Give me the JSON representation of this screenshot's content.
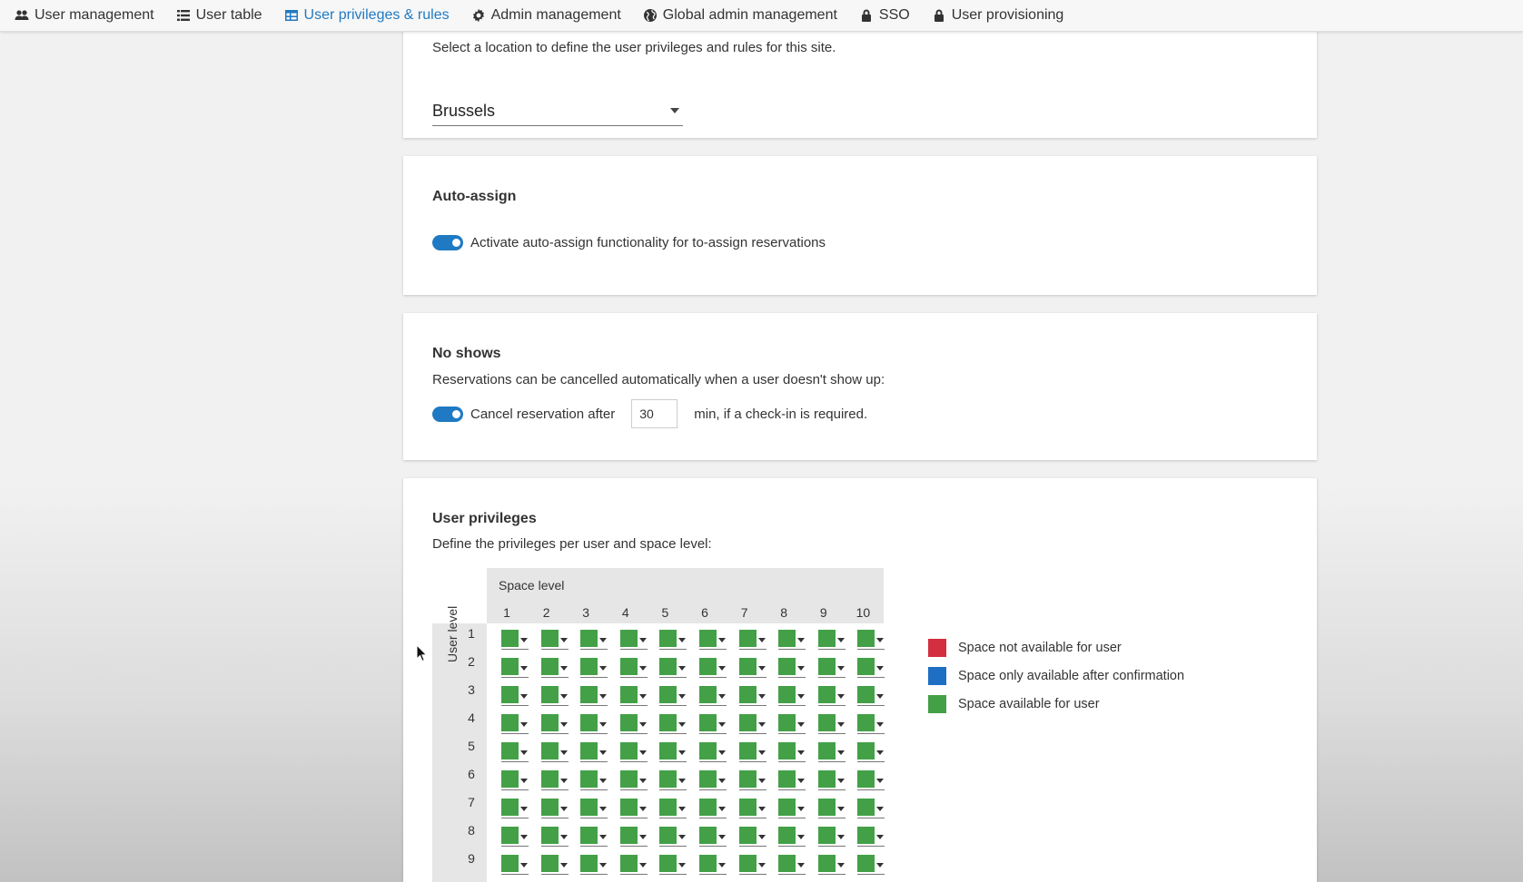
{
  "nav": {
    "tabs": [
      {
        "label": "User management",
        "icon": "users-icon",
        "active": false
      },
      {
        "label": "User table",
        "icon": "list-icon",
        "active": false
      },
      {
        "label": "User privileges & rules",
        "icon": "table-icon",
        "active": true
      },
      {
        "label": "Admin management",
        "icon": "gear-icon",
        "active": false
      },
      {
        "label": "Global admin management",
        "icon": "globe-icon",
        "active": false
      },
      {
        "label": "SSO",
        "icon": "lock-icon",
        "active": false
      },
      {
        "label": "User provisioning",
        "icon": "lock-icon",
        "active": false
      }
    ],
    "active_color": "#1f7ac3"
  },
  "location": {
    "instruction": "Select a location to define the user privileges and rules for this site.",
    "selected": "Brussels"
  },
  "auto_assign": {
    "title": "Auto-assign",
    "toggle_label": "Activate auto-assign functionality for to-assign reservations",
    "enabled": true
  },
  "no_shows": {
    "title": "No shows",
    "description": "Reservations can be cancelled automatically when a user doesn't show up:",
    "cancel_prefix": "Cancel reservation after",
    "minutes": "30",
    "cancel_suffix": "min, if a check-in is required.",
    "enabled": true
  },
  "privileges": {
    "title": "User privileges",
    "description": "Define the privileges per user and space level:",
    "space_level_label": "Space level",
    "user_level_label": "User level",
    "space_levels": [
      "1",
      "2",
      "3",
      "4",
      "5",
      "6",
      "7",
      "8",
      "9",
      "10"
    ],
    "user_levels": [
      "1",
      "2",
      "3",
      "4",
      "5",
      "6",
      "7",
      "8",
      "9"
    ],
    "cell_status": "available",
    "legend": [
      {
        "label": "Space not available for user",
        "color": "#d32f3f"
      },
      {
        "label": "Space only available after confirmation",
        "color": "#1e6fc4"
      },
      {
        "label": "Space available for user",
        "color": "#43a047"
      }
    ]
  }
}
